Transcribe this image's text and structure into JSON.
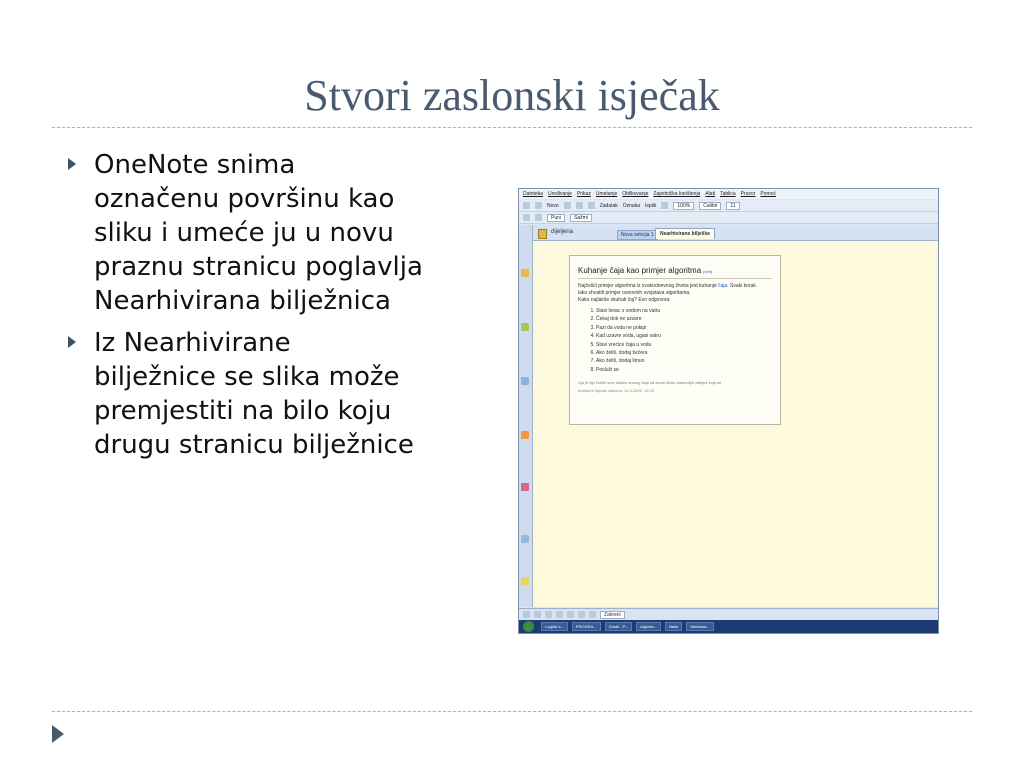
{
  "slide": {
    "title": "Stvori zaslonski isječak",
    "bullets": [
      "OneNote snima\noznačenu površinu kao\nsliku i umeće ju u novu\npraznu stranicu poglavlja\nNearhivirana bilježnica",
      "Iz Nearhivirane\nbilježnice se slika može\npremjestiti na bilo koju\ndrugu stranicu bilježnice"
    ]
  },
  "onenote": {
    "menu": [
      "Datoteka",
      "Uređivanje",
      "Prikaz",
      "Umetanje",
      "Oblikovanje",
      "Zajednička korištenja",
      "Alati",
      "Tablica",
      "Prozor",
      "Pomoć"
    ],
    "toolbar1": {
      "new_label": "Novo",
      "task_label": "Zadatak",
      "tag_label": "Oznaka",
      "close_label": "Ispiši",
      "zoom": "100%",
      "font": "Calibri",
      "size": "11"
    },
    "toolbar2": {
      "view_label": "Puni",
      "collapse_label": "Sažmi"
    },
    "notebook_name": "dijeljena",
    "section_tabs": [
      "Nova sekcija 1",
      "Nearhivirane bilješke"
    ],
    "note": {
      "title": "Kuhanje čaja kao primjer algoritma",
      "title_link": "[veb]",
      "intro_pre": "Najčešći primjer algoritma iz svakodnevnog života jest kuhanje ",
      "intro_link": "čaja",
      "intro_post": ". Svaki korak",
      "intro2": "lako shvatiti primjer osnovnih svojstava algoritama.",
      "question": "Kako najlakše skuhati čaj? Evo odgovora:",
      "steps": [
        "Stavi lonac s vodom na vatru",
        "Čekaj dok ne uzavre",
        "Pazi da voda ne pokipi",
        "Kad uzavre voda, ugasi vatru",
        "Stavi vrećice čaja u vodu",
        "Ako želiš, dodaj šećera",
        "Ako želiš, dodaj limun",
        "Posluži se"
      ],
      "cut_text": "Lijo je tip! Dobili smo čašicu vrućeg čaja na čemu iščito zadovoljili zahtjev koje se",
      "stamp": "Korišteni isječak zaslona: 14.4.2009. 15:25"
    },
    "drawing_bar": {
      "draw_label": "Zakreni"
    },
    "taskbar": [
      "Logički s...",
      "PROGRA...",
      "Gmail - P...",
      "Algorita...",
      "Naše",
      "Windows..."
    ]
  }
}
